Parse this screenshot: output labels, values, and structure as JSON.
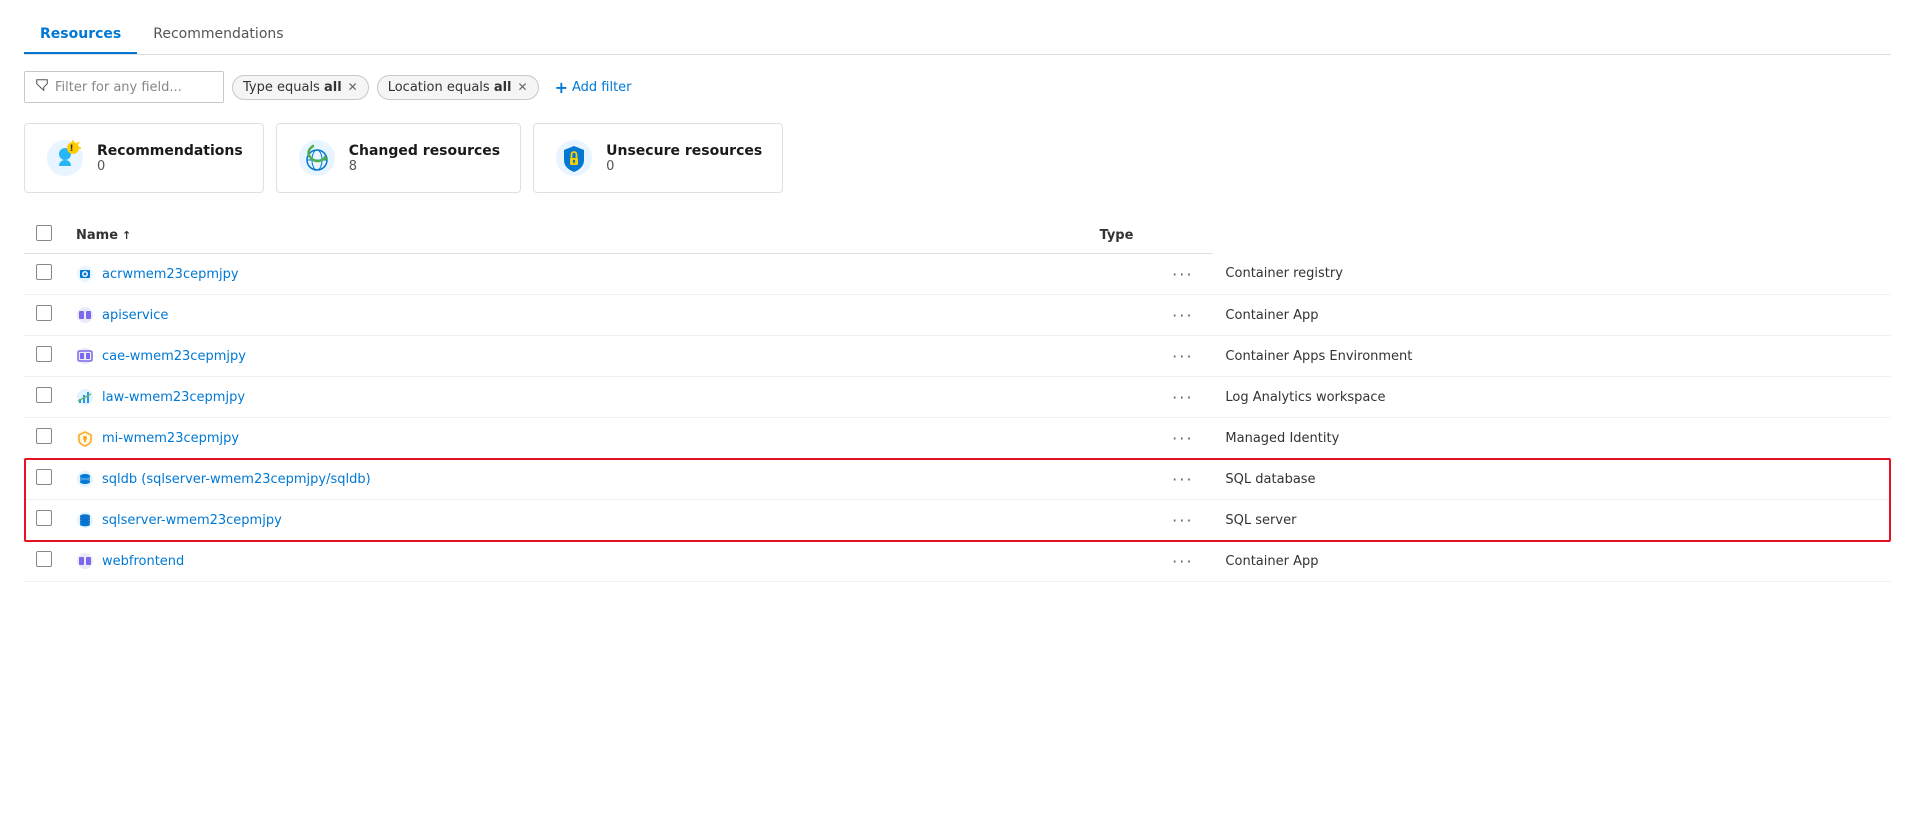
{
  "tabs": [
    {
      "label": "Resources",
      "active": true
    },
    {
      "label": "Recommendations",
      "active": false
    }
  ],
  "filter_bar": {
    "placeholder": "Filter for any field...",
    "chips": [
      {
        "label": "Type equals",
        "bold_part": "all"
      },
      {
        "label": "Location equals",
        "bold_part": "all"
      }
    ],
    "add_filter_label": "Add filter"
  },
  "summary_cards": [
    {
      "icon": "recommendations",
      "title": "Recommendations",
      "count": "0"
    },
    {
      "icon": "changed",
      "title": "Changed resources",
      "count": "8"
    },
    {
      "icon": "unsecure",
      "title": "Unsecure resources",
      "count": "0"
    }
  ],
  "table": {
    "columns": [
      "Name",
      "Type"
    ],
    "rows": [
      {
        "name": "acrwmem23cepmjpy",
        "type": "Container registry",
        "icon": "container-registry",
        "highlighted": false
      },
      {
        "name": "apiservice",
        "type": "Container App",
        "icon": "container-app",
        "highlighted": false
      },
      {
        "name": "cae-wmem23cepmjpy",
        "type": "Container Apps Environment",
        "icon": "container-apps-env",
        "highlighted": false
      },
      {
        "name": "law-wmem23cepmjpy",
        "type": "Log Analytics workspace",
        "icon": "log-analytics",
        "highlighted": false
      },
      {
        "name": "mi-wmem23cepmjpy",
        "type": "Managed Identity",
        "icon": "managed-identity",
        "highlighted": false
      },
      {
        "name": "sqldb (sqlserver-wmem23cepmjpy/sqldb)",
        "type": "SQL database",
        "icon": "sql-database",
        "highlighted": true
      },
      {
        "name": "sqlserver-wmem23cepmjpy",
        "type": "SQL server",
        "icon": "sql-server",
        "highlighted": true
      },
      {
        "name": "webfrontend",
        "type": "Container App",
        "icon": "container-app",
        "highlighted": false
      }
    ]
  }
}
